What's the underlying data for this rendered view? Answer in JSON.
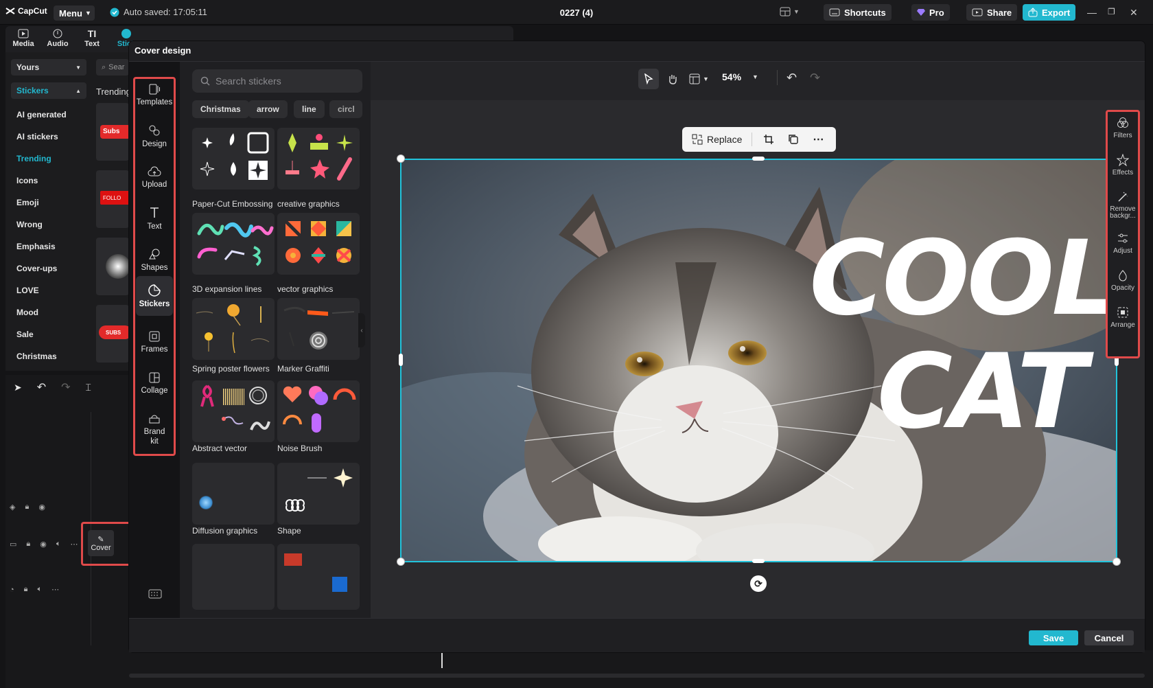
{
  "app": {
    "name": "CapCut",
    "menu_label": "Menu",
    "autosave_text": "Auto saved: 17:05:11",
    "project_title": "0227 (4)"
  },
  "topbar": {
    "shortcuts": "Shortcuts",
    "pro": "Pro",
    "share": "Share",
    "export": "Export"
  },
  "media_tabs": [
    {
      "label": "Media"
    },
    {
      "label": "Audio"
    },
    {
      "label": "Text"
    },
    {
      "label": "Stick"
    }
  ],
  "left_panel": {
    "yours": "Yours",
    "stickers": "Stickers",
    "trending_header": "Trending",
    "search_placeholder": "Sear",
    "categories": [
      "AI generated",
      "AI stickers",
      "Trending",
      "Icons",
      "Emoji",
      "Wrong",
      "Emphasis",
      "Cover-ups",
      "LOVE",
      "Mood",
      "Sale",
      "Christmas"
    ],
    "active_category": "Trending",
    "preview_texts": [
      "Subs",
      "FOLLO",
      "SUBS"
    ]
  },
  "timeline": {
    "cover_label": "Cover"
  },
  "modal": {
    "title": "Cover design",
    "rail": [
      "Templates",
      "Design",
      "Upload",
      "Text",
      "Shapes",
      "Stickers",
      "Frames",
      "Collage",
      "Brand kit"
    ],
    "active_rail": "Stickers",
    "search_placeholder": "Search stickers",
    "chips": [
      "Christmas",
      "arrow",
      "line",
      "circl"
    ],
    "sticker_groups": [
      "Paper-Cut Embossing",
      "creative graphics",
      "3D expansion lines",
      "vector graphics",
      "Spring poster flowers",
      "Marker Graffiti",
      "Abstract vector",
      "Noise Brush",
      "Diffusion graphics",
      "Shape"
    ],
    "zoom": "54%",
    "replace_label": "Replace",
    "canvas_text_line1": "COOL",
    "canvas_text_line2": "CAT",
    "right_tools": [
      "Filters",
      "Effects",
      "Remove backgr...",
      "Adjust",
      "Opacity",
      "Arrange"
    ],
    "save": "Save",
    "cancel": "Cancel"
  },
  "colors": {
    "accent": "#22b8cf",
    "highlight_box": "#e04a4a",
    "selection": "#21c4dc"
  }
}
